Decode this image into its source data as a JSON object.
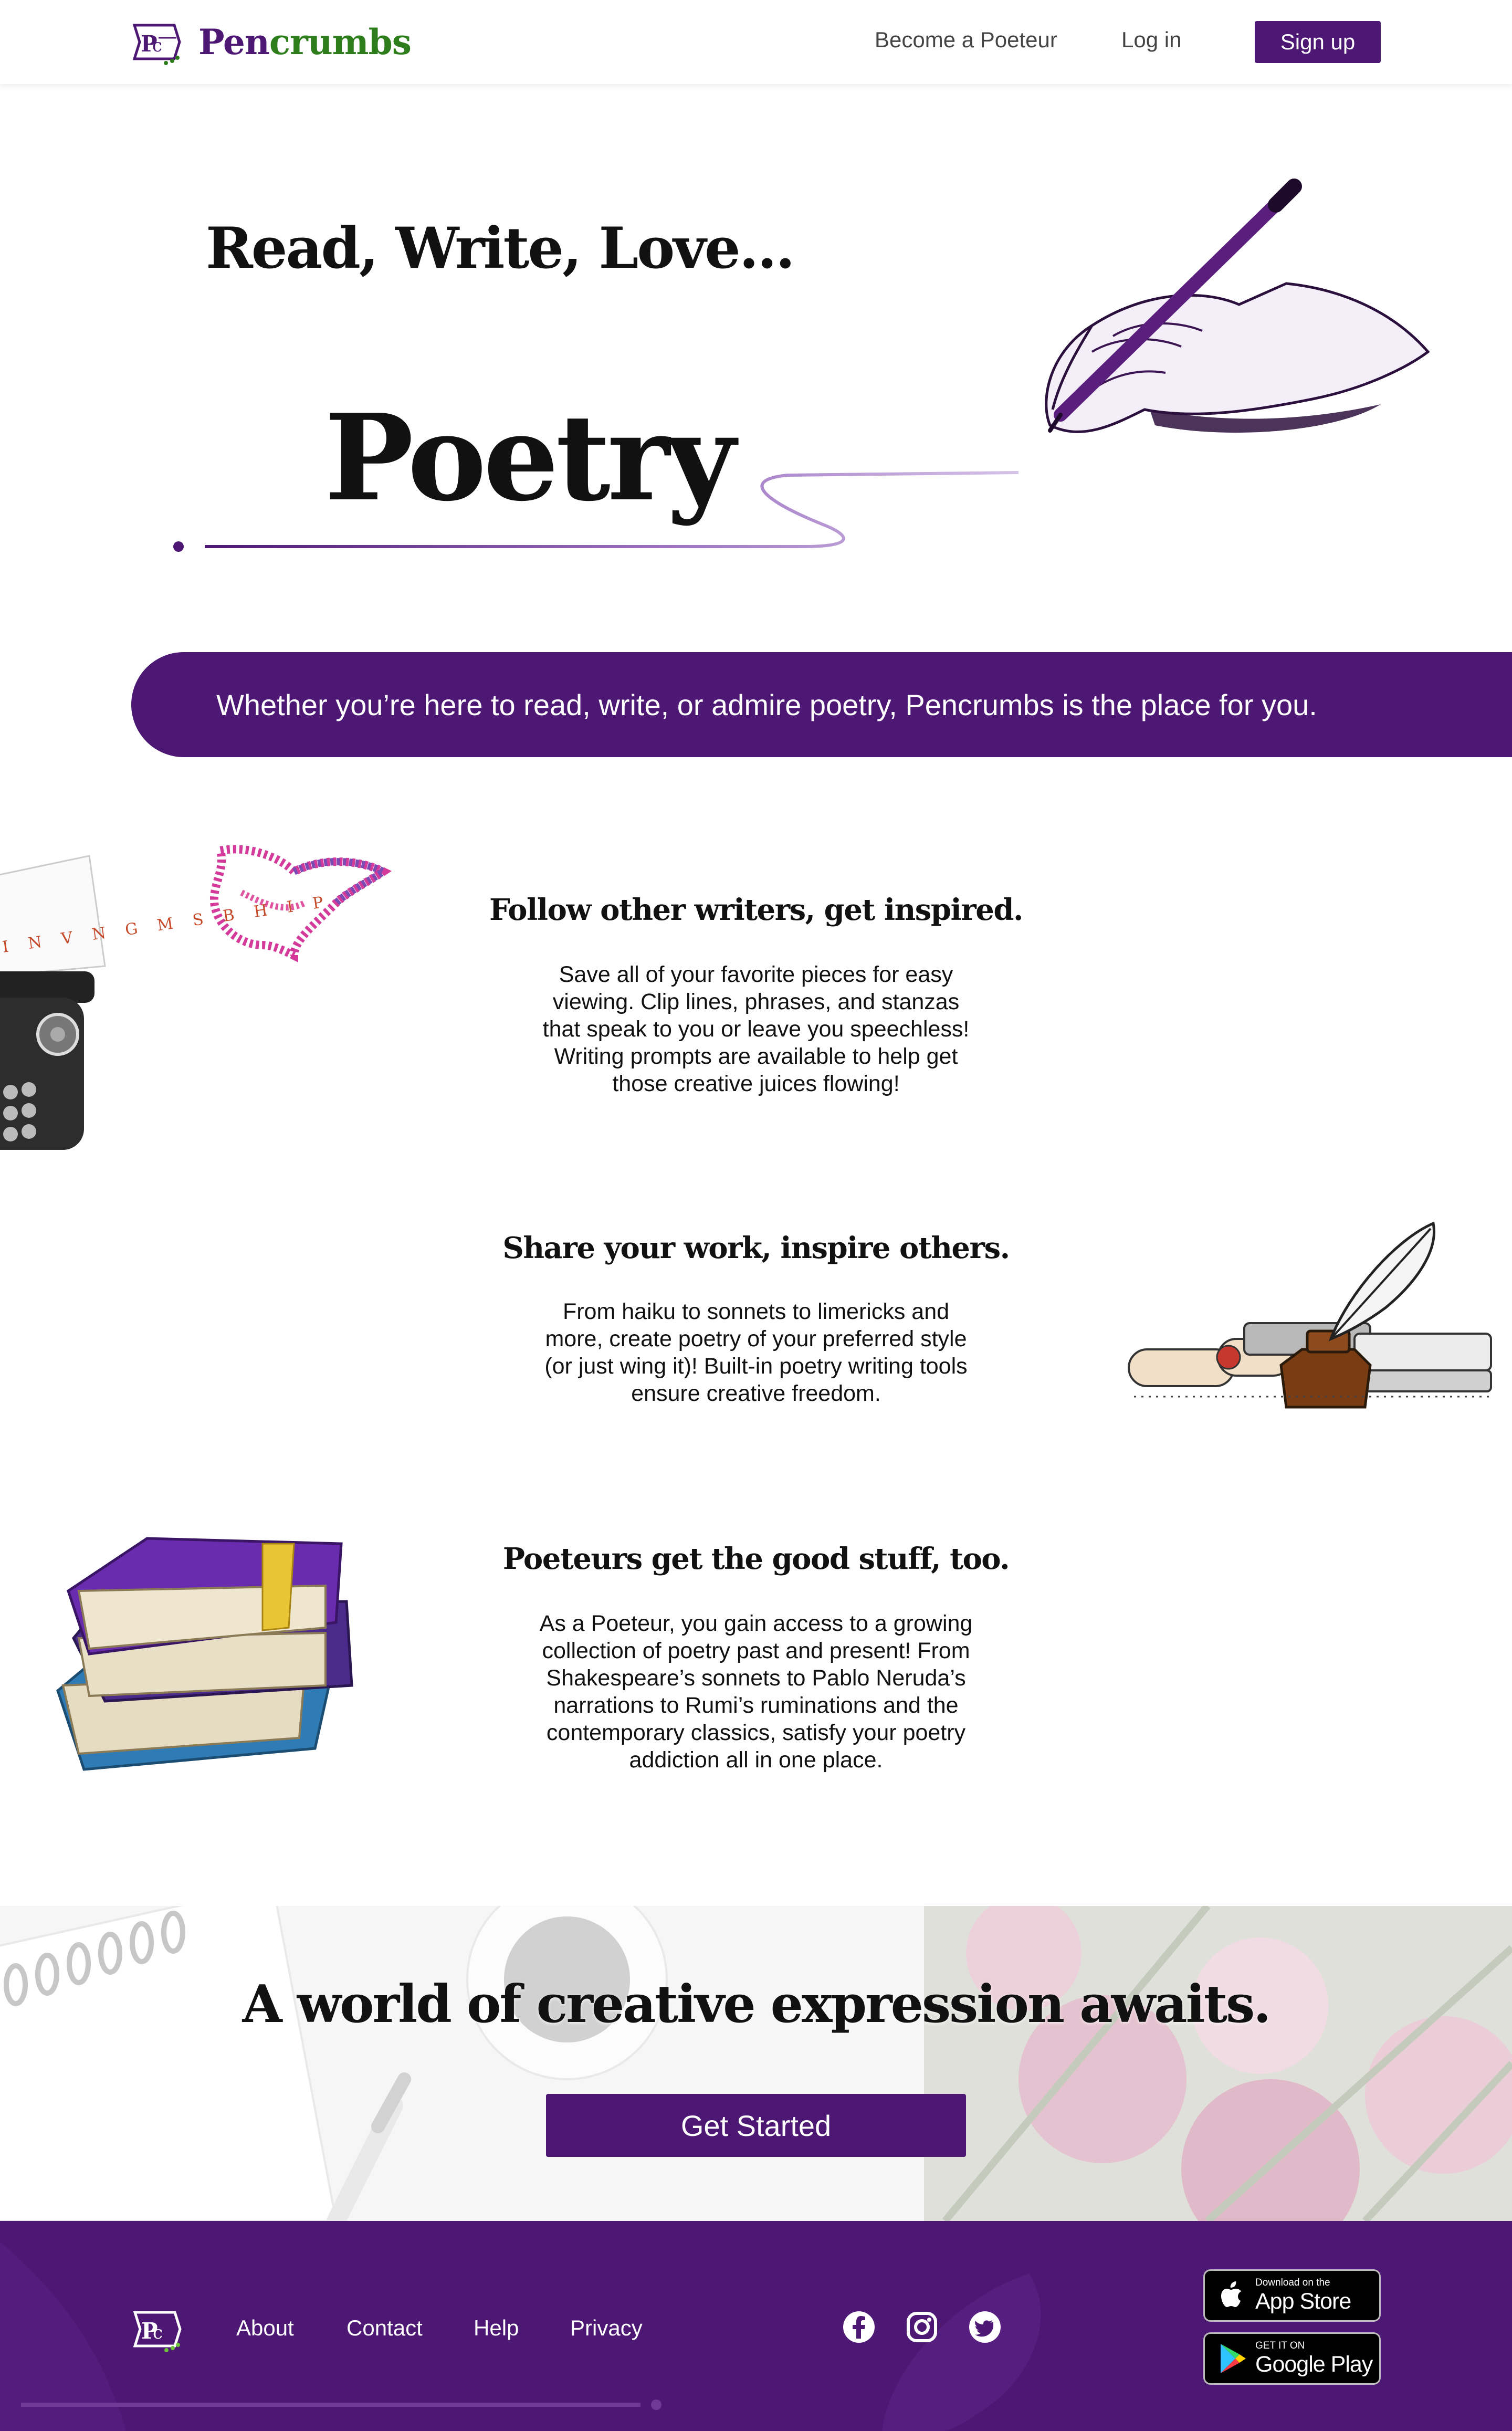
{
  "nav": {
    "logo_pen": "Pen",
    "logo_crumbs": "crumbs",
    "become_poeteur": "Become a Poeteur",
    "login": "Log in",
    "signup": "Sign up"
  },
  "hero": {
    "tagline": "Read, Write, Love...",
    "word": "Poetry"
  },
  "banner": {
    "text": "Whether you’re here to read, write, or admire poetry, Pencrumbs is the place for you."
  },
  "features": [
    {
      "title": "Follow other writers, get inspired.",
      "text": "Save all of your favorite pieces for easy viewing. Clip lines, phrases, and stanzas that speak to you or leave you speechless! Writing prompts are available to help get those creative juices flowing!",
      "illustration": "typewriter-word-bird",
      "bird_letters": "I N V N G M S B H I P"
    },
    {
      "title": "Share your work, inspire others.",
      "text": "From haiku to sonnets to limericks and more, create poetry of your preferred style (or just wing it)! Built-in poetry writing tools ensure creative freedom.",
      "illustration": "quill-inkwell-scrolls"
    },
    {
      "title": "Poeteurs get the good stuff, too.",
      "text": "As a Poeteur, you gain access to a growing collection of poetry past and present! From Shakespeare’s sonnets to Pablo Neruda’s narrations to Rumi’s ruminations and the contemporary classics, satisfy your poetry addiction all in one place.",
      "illustration": "stack-of-books"
    }
  ],
  "cta": {
    "title": "A world of creative expression awaits.",
    "button": "Get Started"
  },
  "footer": {
    "links": [
      "About",
      "Contact",
      "Help",
      "Privacy"
    ],
    "social": [
      "facebook-icon",
      "instagram-icon",
      "twitter-icon"
    ],
    "app_store": {
      "small": "Download on the",
      "big": "App Store"
    },
    "google_play": {
      "small": "GET IT ON",
      "big": "Google Play"
    }
  },
  "colors": {
    "brand_purple": "#4d1774",
    "brand_green": "#2e7d1c",
    "text_dark": "#111111"
  }
}
